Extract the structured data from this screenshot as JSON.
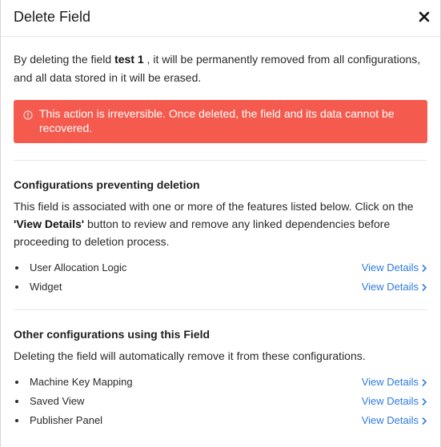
{
  "dialog": {
    "title": "Delete Field",
    "close_icon": "close-icon"
  },
  "intro": {
    "before": "By deleting the field ",
    "field_name": "test 1",
    "after": " , it will be permanently removed from all configurations, and all data stored in it will be erased."
  },
  "alert": {
    "icon": "info-circle-icon",
    "text": "This action is irreversible. Once deleted, the field and its data cannot be recovered.",
    "color": "#f55a4e"
  },
  "preventing": {
    "title": "Configurations preventing deletion",
    "desc_before": "This field is associated with one or more of the features listed below. Click on the ",
    "desc_bold": "'View Details'",
    "desc_after": " button to review and remove any linked dependencies before proceeding to deletion process.",
    "items": [
      {
        "label": "User Allocation Logic",
        "link": "View Details"
      },
      {
        "label": "Widget",
        "link": "View Details"
      }
    ]
  },
  "other": {
    "title": "Other configurations using this Field",
    "desc": "Deleting the field will automatically remove it from these configurations.",
    "items": [
      {
        "label": "Machine Key Mapping",
        "link": "View Details"
      },
      {
        "label": "Saved View",
        "link": "View Details"
      },
      {
        "label": "Publisher Panel",
        "link": "View Details"
      }
    ]
  },
  "colors": {
    "link": "#2f7be0",
    "alert_bg": "#f55a4e"
  }
}
